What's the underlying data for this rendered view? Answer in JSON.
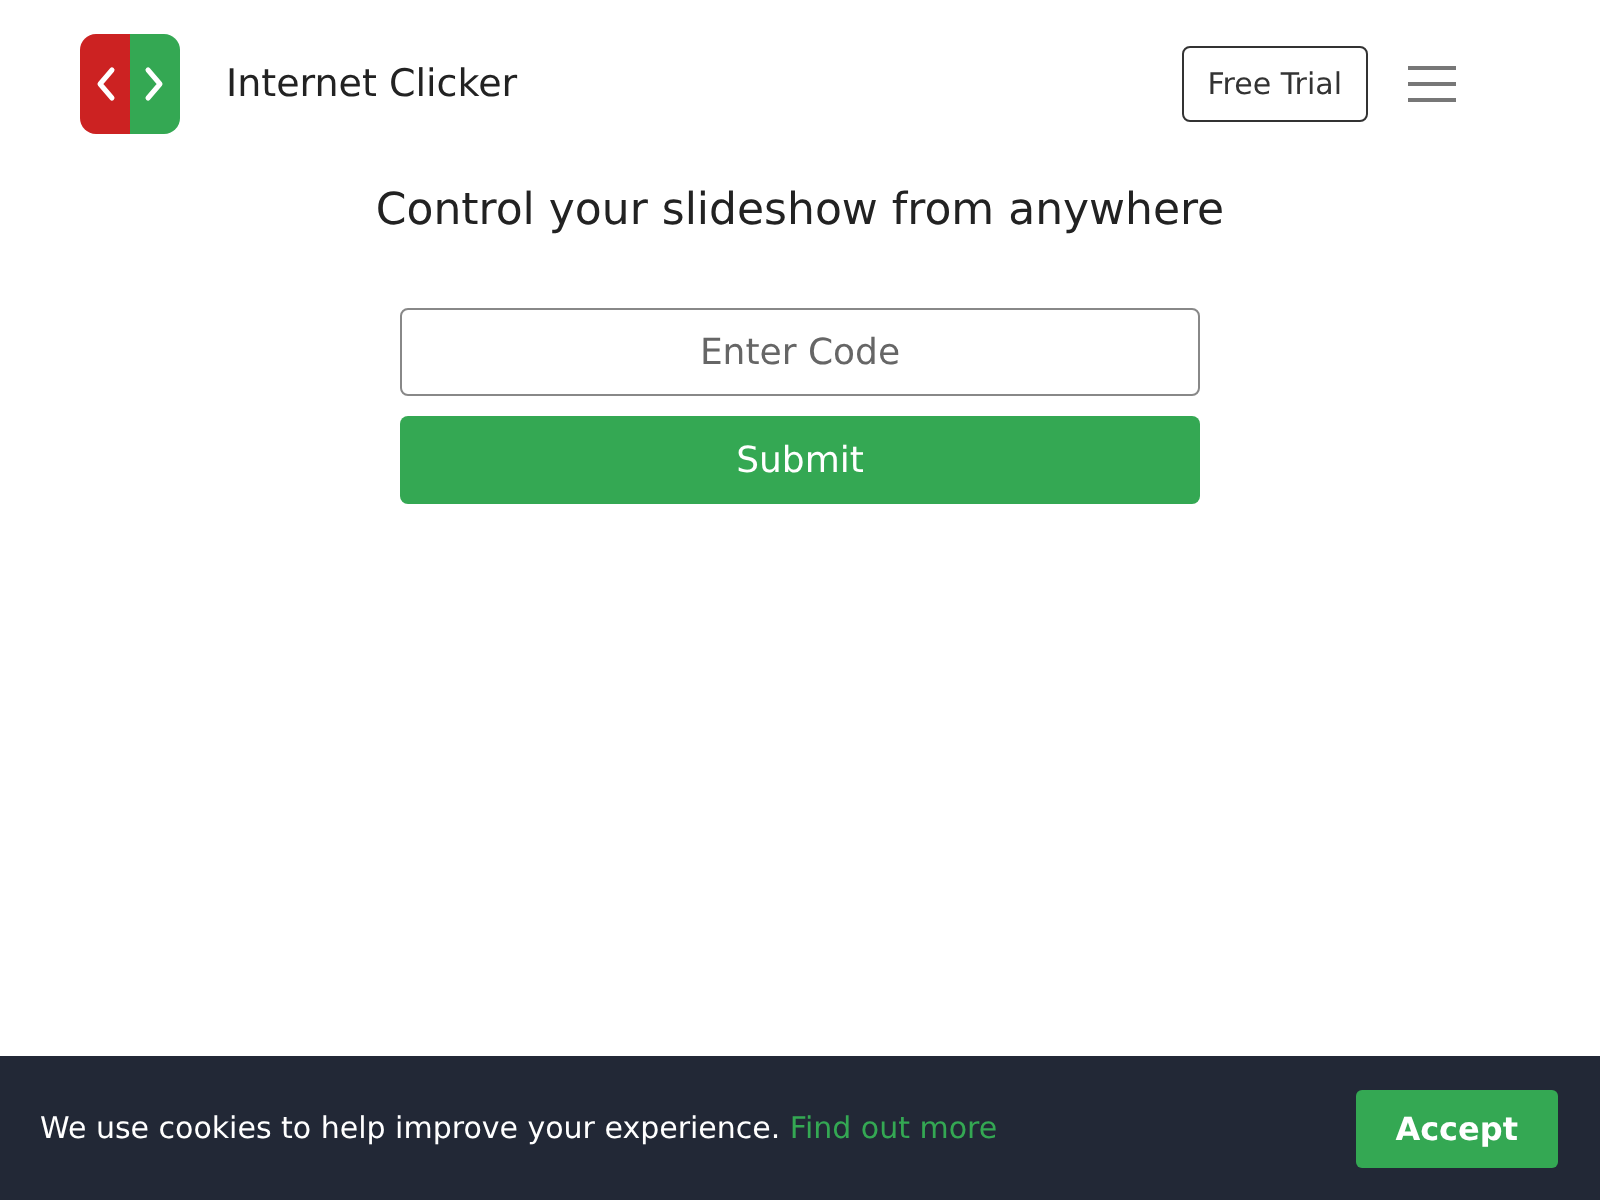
{
  "header": {
    "brand": "Internet Clicker",
    "trial_button": "Free Trial"
  },
  "main": {
    "headline": "Control your slideshow from anywhere",
    "code_field": {
      "placeholder": "Enter Code"
    },
    "submit_button": "Submit"
  },
  "cookie_bar": {
    "message": "We use cookies to help improve your experience.",
    "link": "Find out more",
    "accept_button": "Accept"
  }
}
